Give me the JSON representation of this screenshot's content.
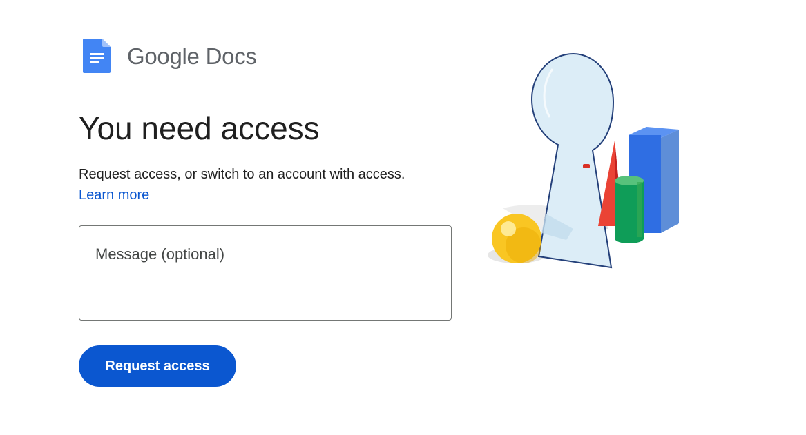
{
  "brand": {
    "google": "Google",
    "product": "Docs"
  },
  "heading": "You need access",
  "description": "Request access, or switch to an account with access.",
  "learn_more_label": "Learn more",
  "message_field": {
    "placeholder": "Message (optional)",
    "value": ""
  },
  "request_button_label": "Request access",
  "colors": {
    "accent": "#0b57d0",
    "text": "#1f1f1f",
    "brand_gray": "#5f6368",
    "docs_icon_blue": "#4285f4"
  },
  "icons": {
    "logo": "google-docs-icon",
    "illustration": "keyhole-illustration"
  }
}
